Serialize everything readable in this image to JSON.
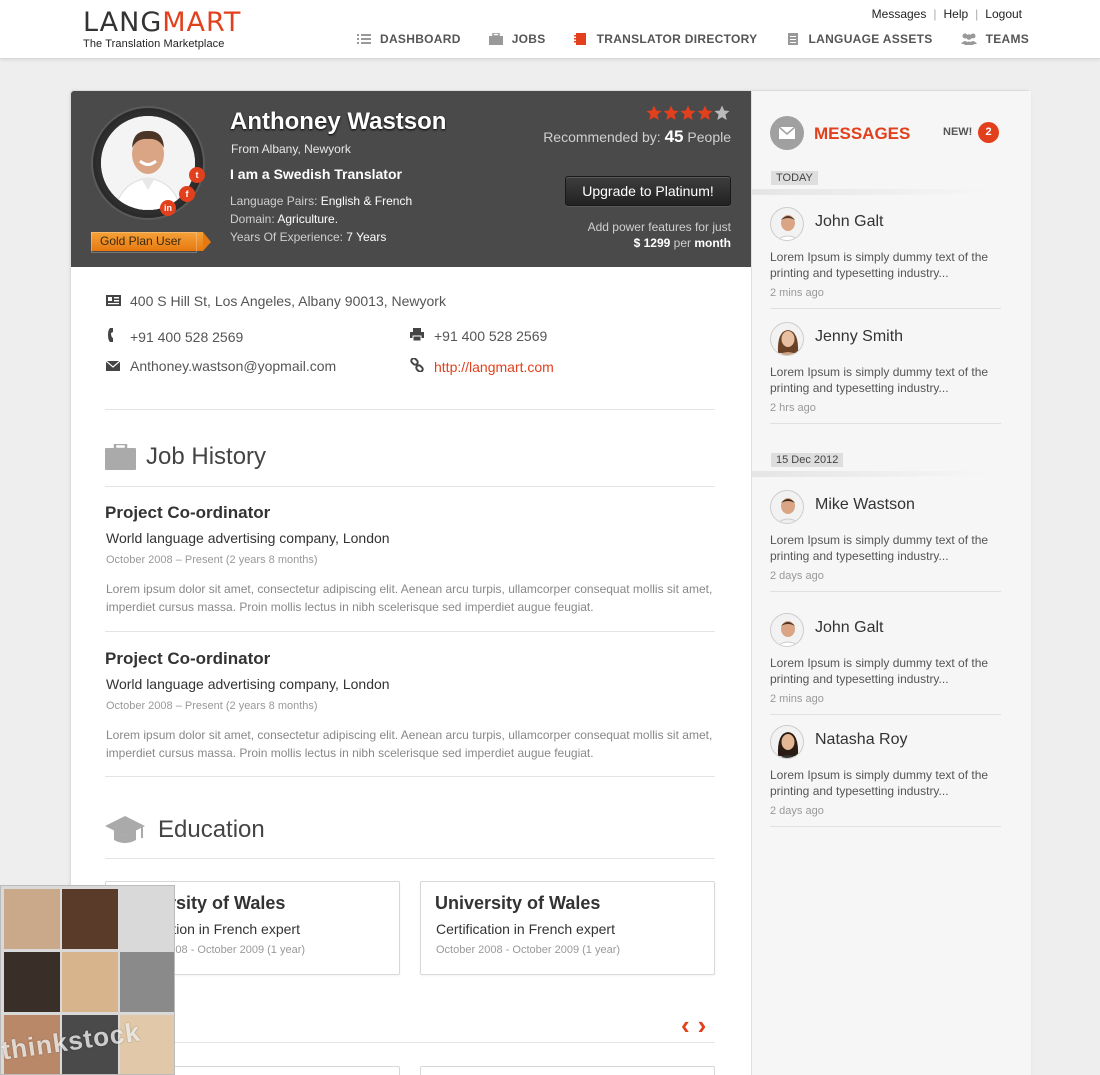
{
  "header": {
    "logo": {
      "part1": "LANG",
      "part2": "MART",
      "tagline": "The Translation Marketplace"
    },
    "top_links": [
      "Messages",
      "Help",
      "Logout"
    ],
    "nav": [
      {
        "label": "DASHBOARD",
        "icon": "list-icon"
      },
      {
        "label": "JOBS",
        "icon": "briefcase-icon"
      },
      {
        "label": "TRANSLATOR DIRECTORY",
        "icon": "address-book-icon"
      },
      {
        "label": "LANGUAGE ASSETS",
        "icon": "document-icon"
      },
      {
        "label": "TEAMS",
        "icon": "people-icon"
      }
    ]
  },
  "profile": {
    "name": "Anthoney Wastson",
    "from": "From Albany, Newyork",
    "title": "I am a Swedish Translator",
    "language_pairs_label": "Language Pairs:",
    "language_pairs": "English & French",
    "domain_label": "Domain:",
    "domain": "Agriculture.",
    "experience_label": "Years Of Experience:",
    "experience": "7 Years",
    "badge": "Gold Plan User",
    "rating": 4,
    "rating_max": 5,
    "recommended_label": "Recommended by:",
    "recommended_count": "45",
    "recommended_suffix": "People",
    "upgrade_button": "Upgrade to Platinum!",
    "power_text": "Add power features for just",
    "price": "$ 1299",
    "per": "per",
    "period": "month",
    "social": [
      "twitter-icon",
      "facebook-icon",
      "linkedin-icon"
    ]
  },
  "contact": {
    "address": "400 S Hill St, Los Angeles, Albany 90013, Newyork",
    "phone": "+91 400 528 2569",
    "fax": "+91 400 528 2569",
    "email": "Anthoney.wastson@yopmail.com",
    "website": "http://langmart.com"
  },
  "job_history": {
    "heading": "Job History",
    "jobs": [
      {
        "title": "Project Co-ordinator",
        "company": "World language advertising company, London",
        "date": "October 2008 – Present (2 years 8 months)",
        "desc": "Lorem ipsum dolor sit amet, consectetur adipiscing elit. Aenean arcu turpis, ullamcorper consequat mollis sit amet, imperdiet cursus massa. Proin mollis lectus in nibh scelerisque sed imperdiet augue feugiat."
      },
      {
        "title": "Project Co-ordinator",
        "company": "World language advertising company, London",
        "date": "October 2008 – Present (2 years 8 months)",
        "desc": "Lorem ipsum dolor sit amet, consectetur adipiscing elit. Aenean arcu turpis, ullamcorper consequat mollis sit amet, imperdiet cursus massa. Proin mollis lectus in nibh scelerisque sed imperdiet augue feugiat."
      }
    ]
  },
  "education": {
    "heading": "Education",
    "items": [
      {
        "university": "University of Wales",
        "cert": "Certification in French expert",
        "date": "October 2008 - October 2009 (1 year)"
      },
      {
        "university": "University of Wales",
        "cert": "Certification in French expert",
        "date": "October 2008 - October 2009 (1 year)"
      }
    ]
  },
  "carousel": {
    "prev": "‹",
    "next": "›"
  },
  "messages": {
    "heading": "MESSAGES",
    "new_label": "NEW!",
    "new_count": "2",
    "groups": [
      {
        "day": "TODAY",
        "items": [
          {
            "name": "John Galt",
            "text": "Lorem Ipsum is simply dummy text of the printing and typesetting industry...",
            "time": "2 mins ago"
          },
          {
            "name": "Jenny Smith",
            "text": "Lorem Ipsum is simply dummy text of the printing and typesetting industry...",
            "time": "2 hrs ago"
          }
        ]
      },
      {
        "day": "15 Dec 2012",
        "items": [
          {
            "name": "Mike Wastson",
            "text": "Lorem Ipsum is simply dummy text of the printing and typesetting industry...",
            "time": "2 days ago"
          },
          {
            "name": "John Galt",
            "text": "Lorem Ipsum is simply dummy text of the printing and typesetting industry...",
            "time": "2 mins ago"
          },
          {
            "name": "Natasha Roy",
            "text": "Lorem Ipsum is simply dummy text of the printing and typesetting industry...",
            "time": "2 days ago"
          }
        ]
      }
    ]
  },
  "watermark": "thinkstock",
  "colors": {
    "accent": "#e2401c",
    "header_dark": "#4a4a4a",
    "ribbon": "#f08a1c"
  }
}
